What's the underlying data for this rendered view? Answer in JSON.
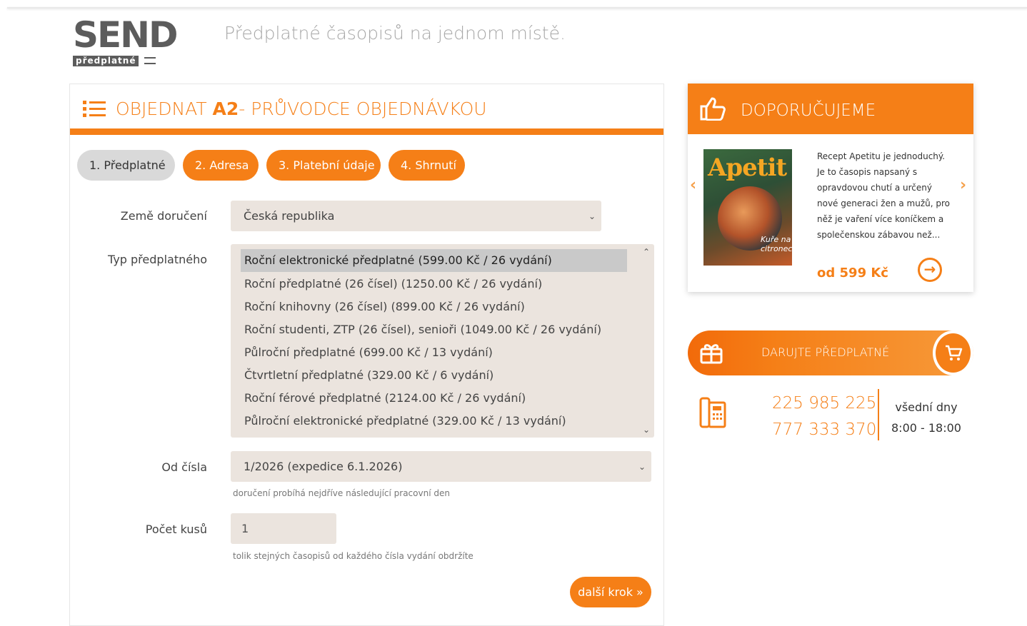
{
  "header": {
    "logo_main": "SEND",
    "logo_sub": "předplatné",
    "tagline": "Předplatné časopisů na jednom místě."
  },
  "order": {
    "title_prefix": "OBJEDNAT ",
    "title_bold": "A2",
    "title_suffix": "- PRŮVODCE OBJEDNÁVKOU",
    "steps": [
      "1. Předplatné",
      "2. Adresa",
      "3. Platební údaje",
      "4. Shrnutí"
    ],
    "country_label": "Země doručení",
    "country_value": "Česká republika",
    "type_label": "Typ předplatného",
    "type_options": [
      "Roční elektronické předplatné (599.00 Kč / 26 vydání)",
      "Roční předplatné (26 čísel) (1250.00 Kč / 26 vydání)",
      "Roční knihovny (26 čísel) (899.00 Kč / 26 vydání)",
      "Roční studenti, ZTP (26 čísel), senioři (1049.00 Kč / 26 vydání)",
      "Půlroční předplatné (699.00 Kč / 13 vydání)",
      "Čtvrtletní předplatné (329.00 Kč / 6 vydání)",
      "Roční férové předplatné (2124.00 Kč / 26 vydání)",
      "Půlroční elektronické předplatné (329.00 Kč / 13 vydání)"
    ],
    "issue_label": "Od čísla",
    "issue_value": "1/2026 (expedice 6.1.2026)",
    "issue_hint": "doručení probíhá nejdříve následující pracovní den",
    "qty_label": "Počet kusů",
    "qty_value": "1",
    "qty_hint": "tolik stejných časopisů od každého čísla vydání obdržíte",
    "next_label": "další krok »"
  },
  "recommend": {
    "title": "DOPORUČUJEME",
    "cover_title": "Apetit",
    "cover_caption": "Kuře na citronech",
    "text": "Recept Apetitu je jednoduchý. Je to časopis napsaný s opravdovou chutí a určený nové generaci žen a mužů, pro něž je vaření více koníčkem a společenskou zábavou než...",
    "price": "od 599 Kč"
  },
  "gift": {
    "label": "DARUJTE PŘEDPLATNÉ"
  },
  "contact": {
    "phone1": "225 985 225",
    "phone2": "777 333 370",
    "days": "všední dny",
    "hours": "8:00 - 18:00"
  },
  "colors": {
    "accent": "#f57f17",
    "field_bg": "#ebe4de",
    "active_step": "#d9d9d9"
  },
  "icons": [
    "list-icon",
    "thumbs-up-icon",
    "gift-icon",
    "cart-icon",
    "phone-icon",
    "arrow-right-circle-icon",
    "chevron-down-icon",
    "chevron-left-icon",
    "chevron-right-icon"
  ]
}
